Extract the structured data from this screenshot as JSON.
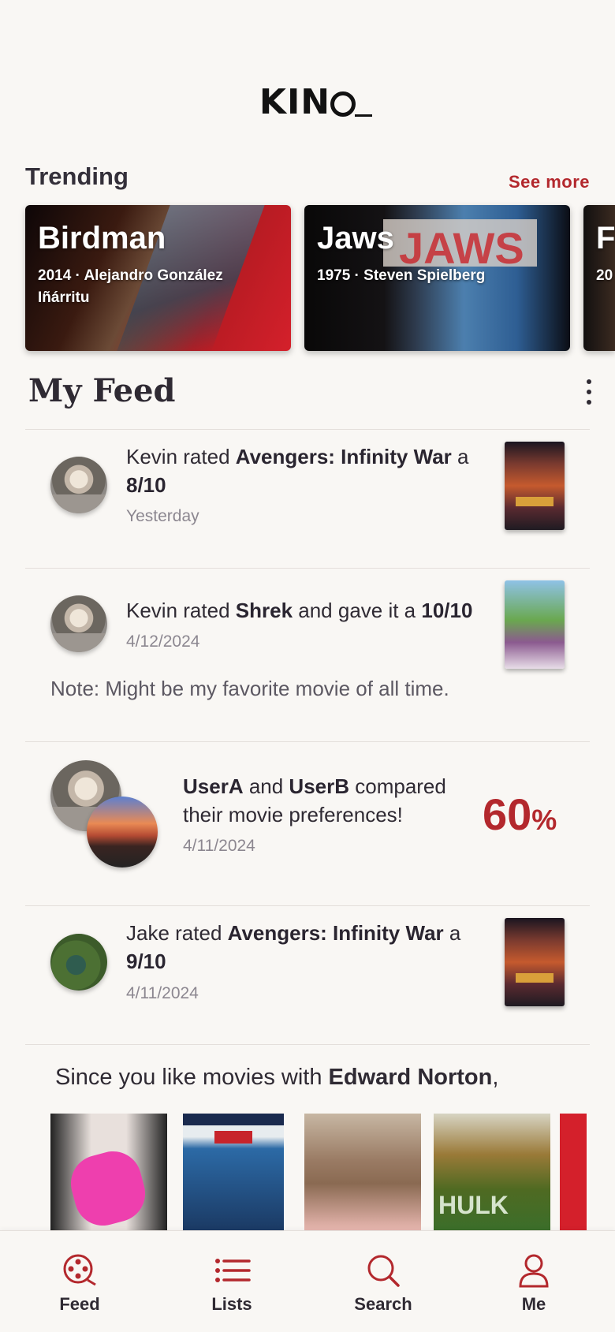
{
  "app": {
    "logo_text": "KIN"
  },
  "trending": {
    "title": "Trending",
    "see_more": "See more",
    "items": [
      {
        "title": "Birdman",
        "meta": "2014 · Alejandro González Iñárritu"
      },
      {
        "title": "Jaws",
        "meta": "1975 · Steven Spielberg"
      },
      {
        "title": "F",
        "meta": "20"
      }
    ]
  },
  "feed": {
    "title": "My Feed",
    "items": [
      {
        "user": "Kevin",
        "verb": " rated ",
        "movie": "Avengers: Infinity War",
        "mid": " a ",
        "score": "8/10",
        "date": "Yesterday"
      },
      {
        "user": "Kevin",
        "verb": " rated ",
        "movie": "Shrek",
        "mid": " and gave it a ",
        "score": "10/10",
        "date": "4/12/2024",
        "note": "Note: Might be my favorite movie of all time."
      },
      {
        "user_a": "UserA",
        "joiner": " and ",
        "user_b": "UserB",
        "rest": " compared their movie preferences!",
        "date": "4/11/2024",
        "percent": "60",
        "percent_sign": "%"
      },
      {
        "user": "Jake",
        "verb": " rated ",
        "movie": "Avengers: Infinity War",
        "mid": " a ",
        "score": "9/10",
        "date": "4/11/2024"
      }
    ],
    "recommendation": {
      "prefix": "Since you like movies with ",
      "actor": "Edward Norton",
      "suffix": ","
    }
  },
  "tabs": [
    {
      "label": "Feed",
      "icon": "film-reel-icon"
    },
    {
      "label": "Lists",
      "icon": "list-icon"
    },
    {
      "label": "Search",
      "icon": "search-icon"
    },
    {
      "label": "Me",
      "icon": "person-icon"
    }
  ],
  "colors": {
    "accent": "#b3282d",
    "background": "#f9f7f4",
    "text": "#2f2a33"
  }
}
